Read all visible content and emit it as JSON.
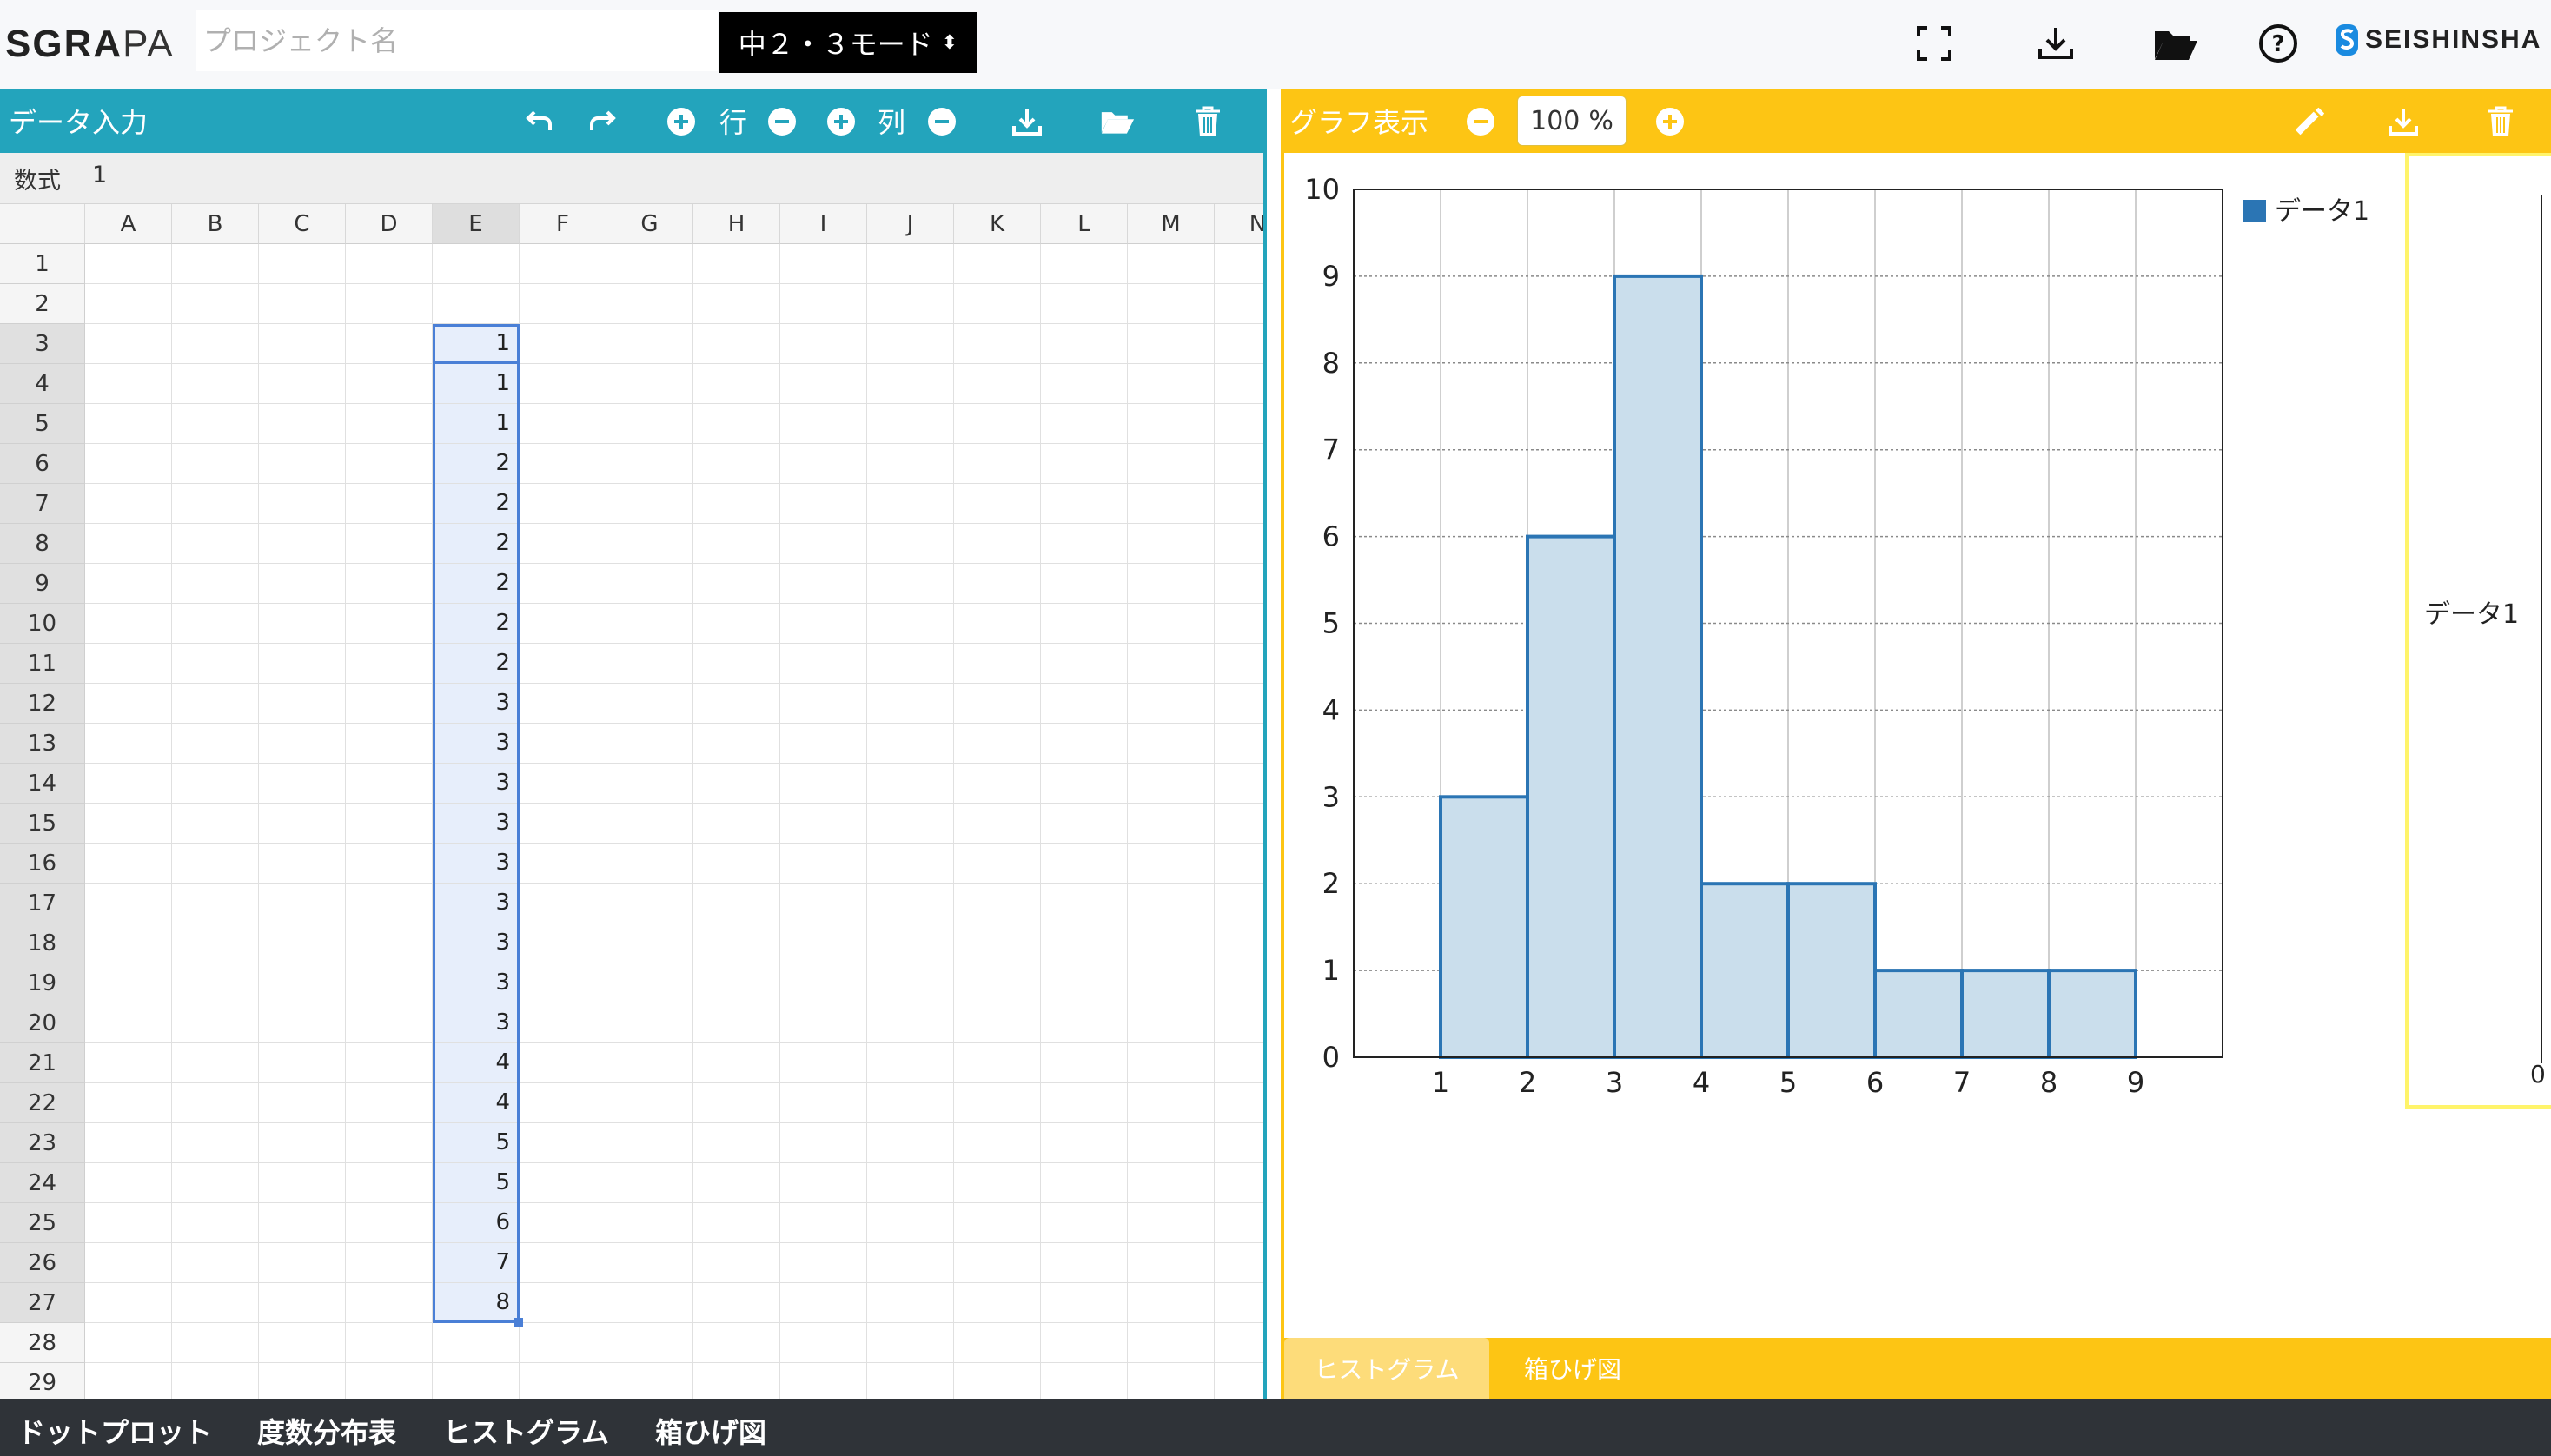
{
  "app": {
    "logo_bold": "SGRA",
    "logo_light": "PA",
    "project_placeholder": "プロジェクト名",
    "mode_label": "中２・３モード",
    "mode_arrows": "⬍",
    "brand": "SEISHINSHA",
    "icons": [
      "fullscreen-icon",
      "download-icon",
      "folder-open-icon",
      "help-icon"
    ]
  },
  "data_panel": {
    "title": "データ入力",
    "row_label": "行",
    "col_label": "列",
    "formula_label": "数式",
    "formula_value": "1",
    "columns": [
      "A",
      "B",
      "C",
      "D",
      "E",
      "F",
      "G",
      "H",
      "I",
      "J",
      "K",
      "L",
      "M",
      "N"
    ],
    "selected_column": "E",
    "rows": [
      "1",
      "2",
      "3",
      "4",
      "5",
      "6",
      "7",
      "8",
      "9",
      "10",
      "11",
      "12",
      "13",
      "14",
      "15",
      "16",
      "17",
      "18",
      "19",
      "20",
      "21",
      "22",
      "23",
      "24",
      "25",
      "26",
      "27",
      "28",
      "29"
    ],
    "selected_rows_from": 3,
    "selected_rows_to": 27,
    "column_e_values": [
      "",
      "",
      "1",
      "1",
      "1",
      "2",
      "2",
      "2",
      "2",
      "2",
      "2",
      "3",
      "3",
      "3",
      "3",
      "3",
      "3",
      "3",
      "3",
      "3",
      "4",
      "4",
      "5",
      "5",
      "6",
      "7",
      "8",
      "",
      ""
    ]
  },
  "graph_panel": {
    "title": "グラフ表示",
    "zoom_value": "100",
    "zoom_unit": "%",
    "tabs": [
      {
        "label": "ヒストグラム",
        "active": false
      },
      {
        "label": "箱ひげ図",
        "active": true
      }
    ],
    "boxplot": {
      "series_label": "データ1",
      "axis_zero": "0"
    }
  },
  "chart_data": {
    "type": "bar",
    "title": "",
    "xlabel": "",
    "ylabel": "",
    "bin_edges": [
      1,
      2,
      3,
      4,
      5,
      6,
      7,
      8,
      9
    ],
    "x_ticks": [
      "1",
      "2",
      "3",
      "4",
      "5",
      "6",
      "7",
      "8",
      "9"
    ],
    "values": [
      3,
      6,
      9,
      2,
      2,
      1,
      1,
      1
    ],
    "ylim": [
      0,
      10
    ],
    "y_ticks": [
      "0",
      "1",
      "2",
      "3",
      "4",
      "5",
      "6",
      "7",
      "8",
      "9",
      "10"
    ],
    "grid": true,
    "legend": "top-right",
    "series": [
      {
        "name": "データ1",
        "values": [
          3,
          6,
          9,
          2,
          2,
          1,
          1,
          1
        ]
      }
    ],
    "bar_fill": "#cadeec",
    "bar_stroke": "#2b75b4"
  },
  "bottom_nav": [
    "ドットプロット",
    "度数分布表",
    "ヒストグラム",
    "箱ひげ図"
  ],
  "colors": {
    "data_header": "#23a4bc",
    "graph_header": "#fdc514",
    "bottom_bar": "#2f3338",
    "selection": "#4a7fd6",
    "tab_inactive": "#fddc7a",
    "tab_active": "#fdc514"
  }
}
